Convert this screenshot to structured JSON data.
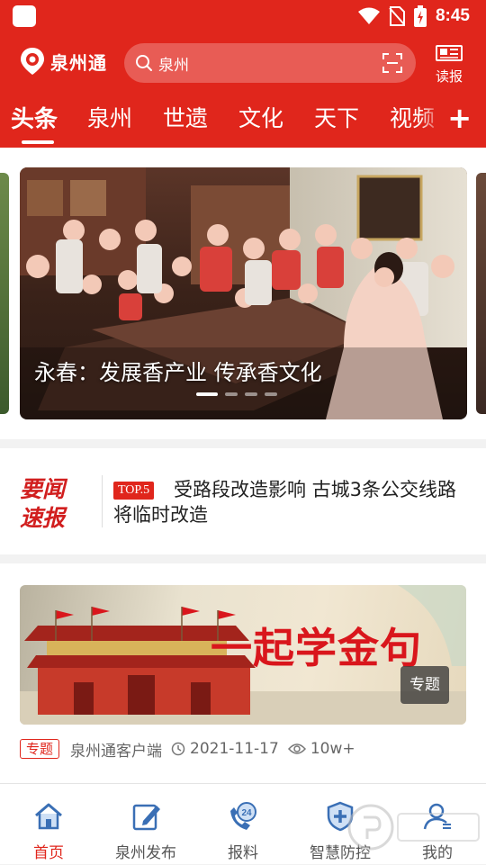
{
  "status_bar": {
    "time": "8:45"
  },
  "header": {
    "app_name": "泉州通",
    "search": {
      "value": "泉州"
    },
    "read_paper_label": "读报",
    "tabs": [
      {
        "label": "头条",
        "active": true
      },
      {
        "label": "泉州",
        "active": false
      },
      {
        "label": "世遗",
        "active": false
      },
      {
        "label": "文化",
        "active": false
      },
      {
        "label": "天下",
        "active": false
      },
      {
        "label": "视频",
        "active": false
      }
    ],
    "add_tab_label": "+"
  },
  "carousel": {
    "caption": "永春：发展香产业 传承香文化",
    "slide_count": 4,
    "active_index": 0
  },
  "news_flash": {
    "logo_line1": "要闻",
    "logo_line2": "速报",
    "badge": "TOP.5",
    "text": "受路段改造影响 古城3条公交线路将临时改造"
  },
  "feature_card": {
    "banner_title": "一起学金句",
    "banner_badge": "专题",
    "tag": "专题",
    "source": "泉州通客户端",
    "date": "2021-11-17",
    "views": "10w+"
  },
  "bottom_nav": [
    {
      "label": "首页",
      "icon": "home-icon",
      "active": true
    },
    {
      "label": "泉州发布",
      "icon": "edit-icon",
      "active": false
    },
    {
      "label": "报料",
      "icon": "phone-24-icon",
      "active": false
    },
    {
      "label": "智慧防控",
      "icon": "shield-plus-icon",
      "active": false
    },
    {
      "label": "我的",
      "icon": "user-icon",
      "active": false
    }
  ],
  "colors": {
    "brand_red": "#e0261c",
    "active_nav": "#e0261c"
  }
}
